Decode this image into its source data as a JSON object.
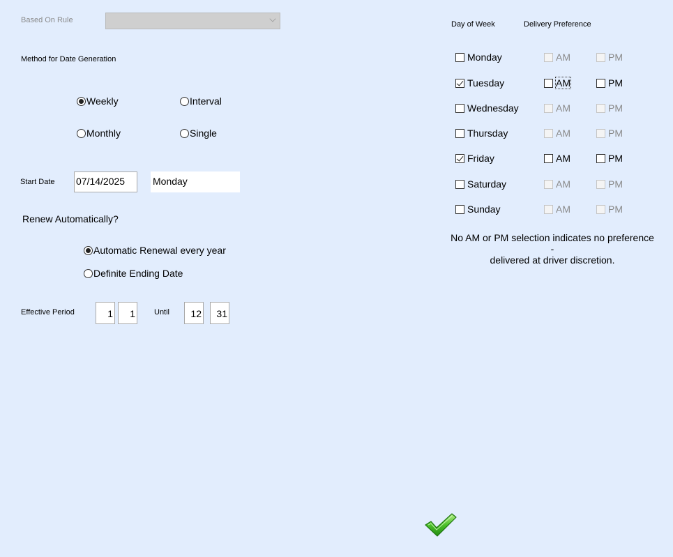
{
  "based_on_rule": {
    "label": "Based On Rule",
    "value": ""
  },
  "method": {
    "label": "Method for Date Generation",
    "options": [
      {
        "label": "Weekly",
        "selected": true
      },
      {
        "label": "Interval",
        "selected": false
      },
      {
        "label": "Monthly",
        "selected": false
      },
      {
        "label": "Single",
        "selected": false
      }
    ]
  },
  "start_date": {
    "label": "Start Date",
    "value": "07/14/2025",
    "day_name": "Monday"
  },
  "renew": {
    "label": "Renew Automatically?",
    "options": [
      {
        "label": "Automatic Renewal every year",
        "selected": true
      },
      {
        "label": "Definite Ending Date",
        "selected": false
      }
    ]
  },
  "effective_period": {
    "label": "Effective Period",
    "from_month": "1",
    "from_day": "1",
    "until_label": "Until",
    "to_month": "12",
    "to_day": "31"
  },
  "schedule": {
    "day_header": "Day of Week",
    "pref_header": "Delivery Preference",
    "am_label": "AM",
    "pm_label": "PM",
    "days": [
      {
        "name": "Monday",
        "checked": false,
        "am": false,
        "pm": false,
        "enabled": false
      },
      {
        "name": "Tuesday",
        "checked": true,
        "am": false,
        "pm": false,
        "enabled": true
      },
      {
        "name": "Wednesday",
        "checked": false,
        "am": false,
        "pm": false,
        "enabled": false
      },
      {
        "name": "Thursday",
        "checked": false,
        "am": false,
        "pm": false,
        "enabled": false
      },
      {
        "name": "Friday",
        "checked": true,
        "am": false,
        "pm": false,
        "enabled": true
      },
      {
        "name": "Saturday",
        "checked": false,
        "am": false,
        "pm": false,
        "enabled": false
      },
      {
        "name": "Sunday",
        "checked": false,
        "am": false,
        "pm": false,
        "enabled": false
      }
    ],
    "note_line1": "No AM or PM selection indicates no preference -",
    "note_line2": "delivered at driver discretion."
  },
  "colors": {
    "background": "#e2edfd",
    "check_green": "#3cae1e"
  },
  "icons": {
    "ok": "green-checkmark-icon"
  }
}
